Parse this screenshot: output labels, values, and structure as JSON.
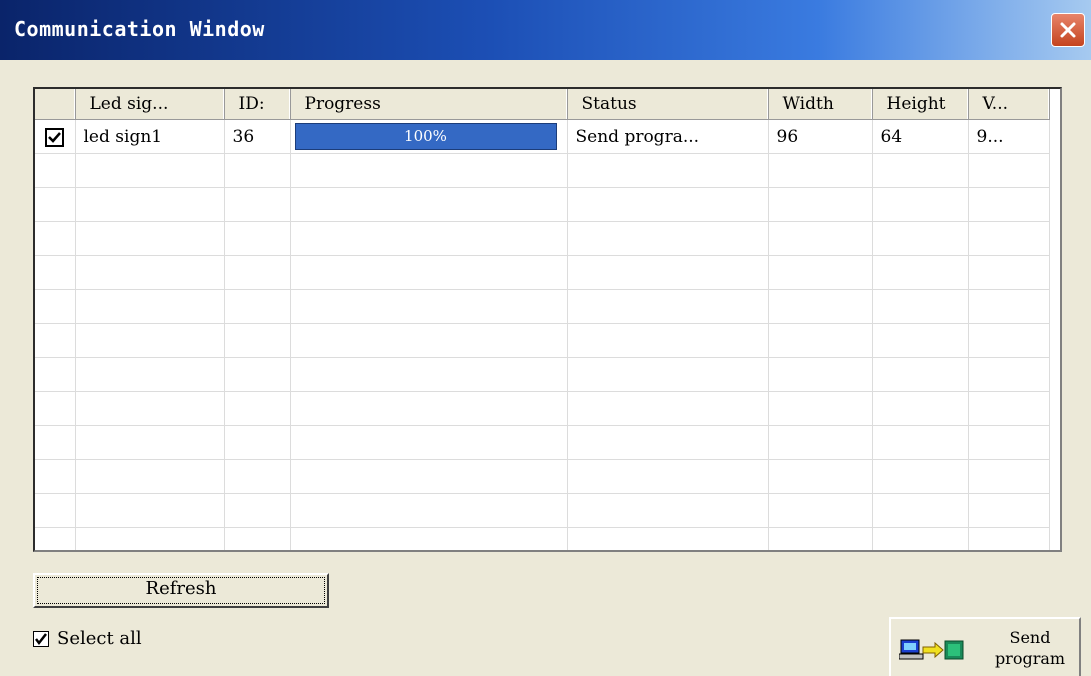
{
  "window": {
    "title": "Communication Window"
  },
  "columns": [
    "",
    "Led sig...",
    "ID:",
    "Progress",
    "Status",
    "Width",
    "Height",
    "V..."
  ],
  "rows": [
    {
      "checked": true,
      "name": "led sign1",
      "id": "36",
      "progress": 100,
      "progress_label": "100%",
      "status": "Send progra...",
      "width": "96",
      "height": "64",
      "v": "9..."
    }
  ],
  "buttons": {
    "refresh": "Refresh",
    "send_line1": "Send",
    "send_line2": "program"
  },
  "select_all": {
    "label": "Select all",
    "checked": true
  },
  "icons": {
    "close": "close-icon",
    "send": "send-program-icon",
    "checkbox": "check-icon"
  },
  "colors": {
    "title_start": "#0a246a",
    "title_end": "#a6caf0",
    "progress_fill": "#3469c4",
    "close": "#c4441f"
  }
}
